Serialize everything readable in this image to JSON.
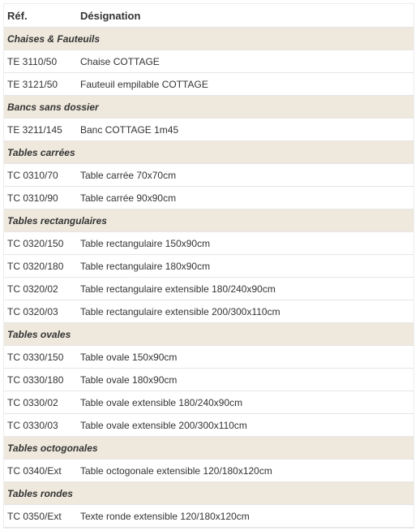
{
  "table": {
    "headers": {
      "ref": "Réf.",
      "designation": "Désignation"
    },
    "groups": [
      {
        "category": "Chaises & Fauteuils",
        "items": [
          {
            "ref": "TE 3110/50",
            "designation": "Chaise COTTAGE"
          },
          {
            "ref": "TE 3121/50",
            "designation": "Fauteuil empilable COTTAGE"
          }
        ]
      },
      {
        "category": "Bancs sans dossier",
        "items": [
          {
            "ref": "TE 3211/145",
            "designation": "Banc COTTAGE 1m45"
          }
        ]
      },
      {
        "category": "Tables carrées",
        "items": [
          {
            "ref": "TC 0310/70",
            "designation": "Table carrée 70x70cm"
          },
          {
            "ref": "TC 0310/90",
            "designation": "Table carrée 90x90cm"
          }
        ]
      },
      {
        "category": "Tables rectangulaires",
        "items": [
          {
            "ref": "TC 0320/150",
            "designation": "Table rectangulaire 150x90cm"
          },
          {
            "ref": "TC 0320/180",
            "designation": "Table rectangulaire 180x90cm"
          },
          {
            "ref": "TC 0320/02",
            "designation": "Table rectangulaire extensible 180/240x90cm"
          },
          {
            "ref": "TC 0320/03",
            "designation": "Table rectangulaire extensible 200/300x110cm"
          }
        ]
      },
      {
        "category": "Tables ovales",
        "items": [
          {
            "ref": "TC 0330/150",
            "designation": "Table ovale 150x90cm"
          },
          {
            "ref": "TC 0330/180",
            "designation": "Table ovale 180x90cm"
          },
          {
            "ref": "TC 0330/02",
            "designation": "Table ovale extensible 180/240x90cm"
          },
          {
            "ref": "TC 0330/03",
            "designation": "Table ovale extensible 200/300x110cm"
          }
        ]
      },
      {
        "category": "Tables octogonales",
        "items": [
          {
            "ref": "TC 0340/Ext",
            "designation": "Table octogonale extensible 120/180x120cm"
          }
        ]
      },
      {
        "category": "Tables rondes",
        "items": [
          {
            "ref": "TC 0350/Ext",
            "designation": "Texte ronde extensible 120/180x120cm"
          }
        ]
      }
    ]
  },
  "colors": {
    "category_bg": "#efe9dd",
    "border": "#e6e6e6",
    "text": "#333333"
  }
}
